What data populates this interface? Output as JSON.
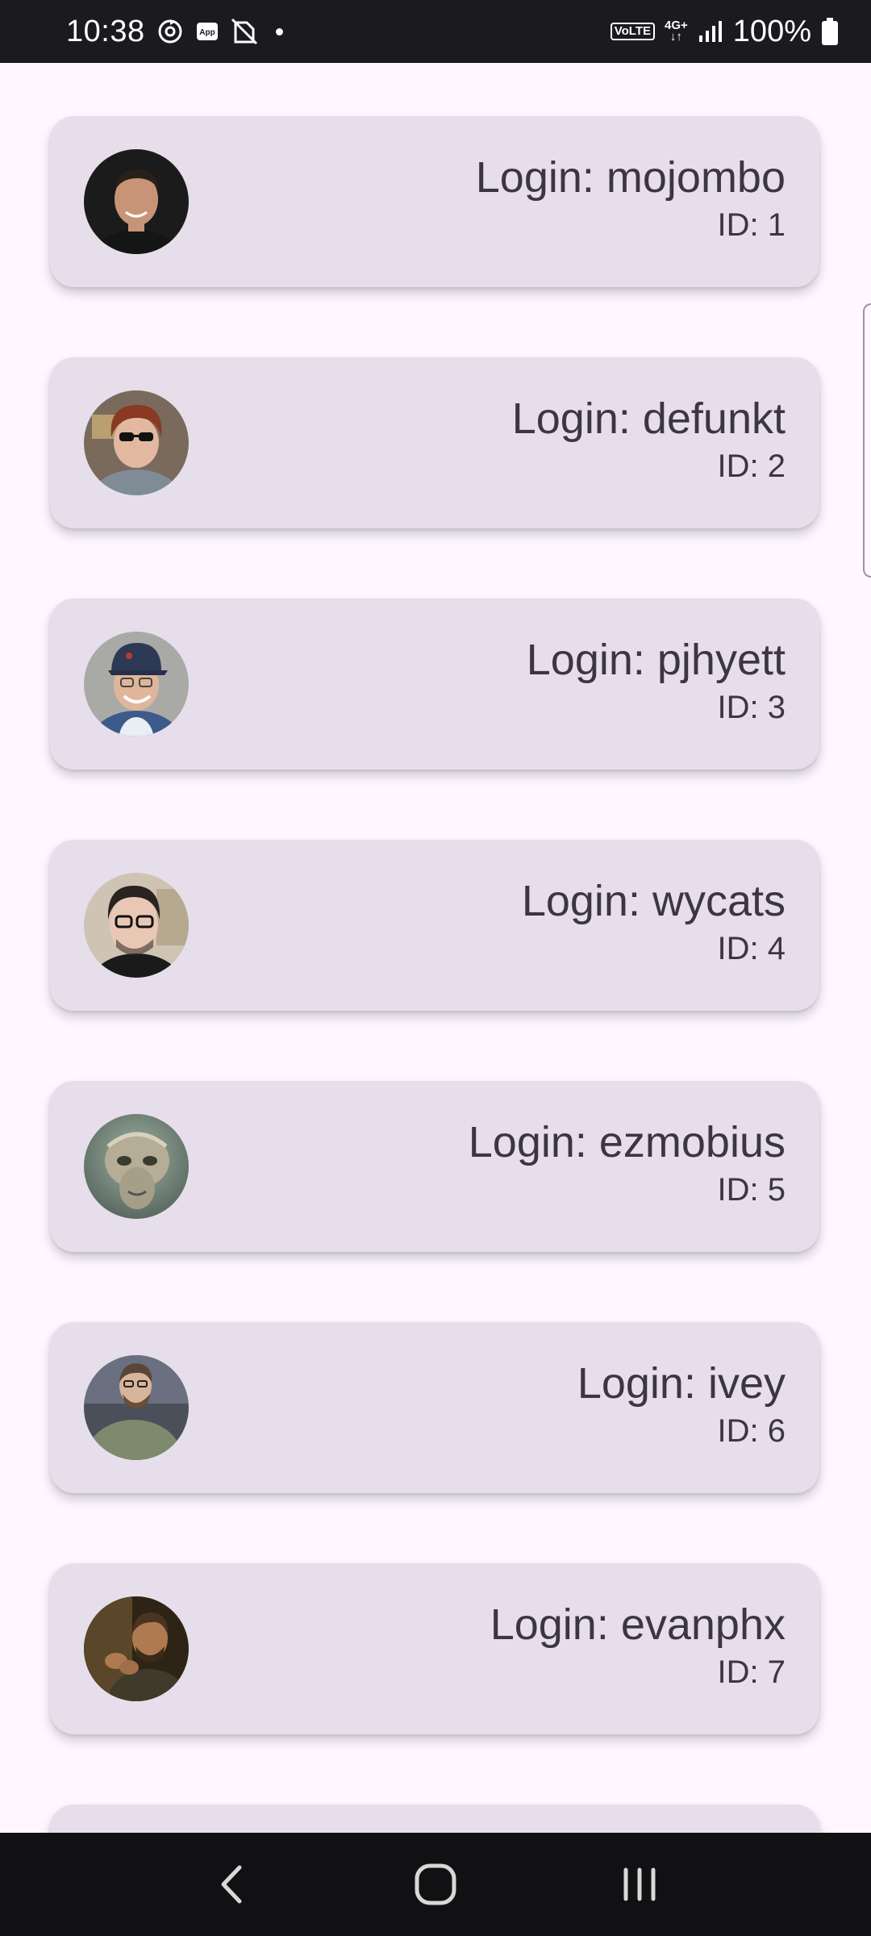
{
  "status_bar": {
    "time": "10:38",
    "battery_text": "100%",
    "volte_label": "VoLTE",
    "network_label": "4G+",
    "icons": [
      "sync-icon",
      "app-notification-icon",
      "no-sim-icon",
      "notification-dot-icon",
      "volte-icon",
      "network-4g-icon",
      "signal-icon",
      "battery-icon"
    ]
  },
  "users": [
    {
      "login_prefix": "Login: ",
      "login": "mojombo",
      "login_line": "Login: mojombo",
      "id_line": "ID: 1",
      "avatar_colors": {
        "bg": "#1b1b1b",
        "skin": "#c89478",
        "hair": "#2a2018",
        "shirt": "#151515"
      }
    },
    {
      "login_line": "Login: defunkt",
      "id_line": "ID: 2",
      "avatar_colors": {
        "bg": "#7a6a5c",
        "skin": "#e3b8a0",
        "hair": "#8a3a22",
        "shirt": "#7f8c98"
      }
    },
    {
      "login_line": "Login: pjhyett",
      "id_line": "ID: 3",
      "avatar_colors": {
        "bg": "#a9aaa6",
        "skin": "#e0b59a",
        "hair": "#2e3a55",
        "shirt": "#3d5a8a"
      }
    },
    {
      "login_line": "Login: wycats",
      "id_line": "ID: 4",
      "avatar_colors": {
        "bg": "#cfc4b4",
        "skin": "#e8c8b4",
        "hair": "#2a2420",
        "shirt": "#1a1a1a"
      }
    },
    {
      "login_line": "Login: ezmobius",
      "id_line": "ID: 5",
      "avatar_colors": {
        "bg": "#6f7f70",
        "skin": "#b6ad96",
        "hair": "#8e8c76",
        "shirt": "#5d6b63"
      }
    },
    {
      "login_line": "Login: ivey",
      "id_line": "ID: 6",
      "avatar_colors": {
        "bg": "#4a4f5a",
        "skin": "#d8b49a",
        "hair": "#5a4636",
        "shirt": "#7e8a6e"
      }
    },
    {
      "login_line": "Login: evanphx",
      "id_line": "ID: 7",
      "avatar_colors": {
        "bg": "#2e2416",
        "skin": "#b07a50",
        "hair": "#4a3420",
        "shirt": "#3f3a2a"
      }
    }
  ],
  "nav_bar": {
    "buttons": [
      "back-icon",
      "home-icon",
      "recents-icon"
    ]
  },
  "colors": {
    "status_bar_bg": "#1a1a1f",
    "page_bg": "#fef7ff",
    "card_bg": "#e6dfeb",
    "text": "#3c3642",
    "nav_bar_bg": "#111114"
  }
}
